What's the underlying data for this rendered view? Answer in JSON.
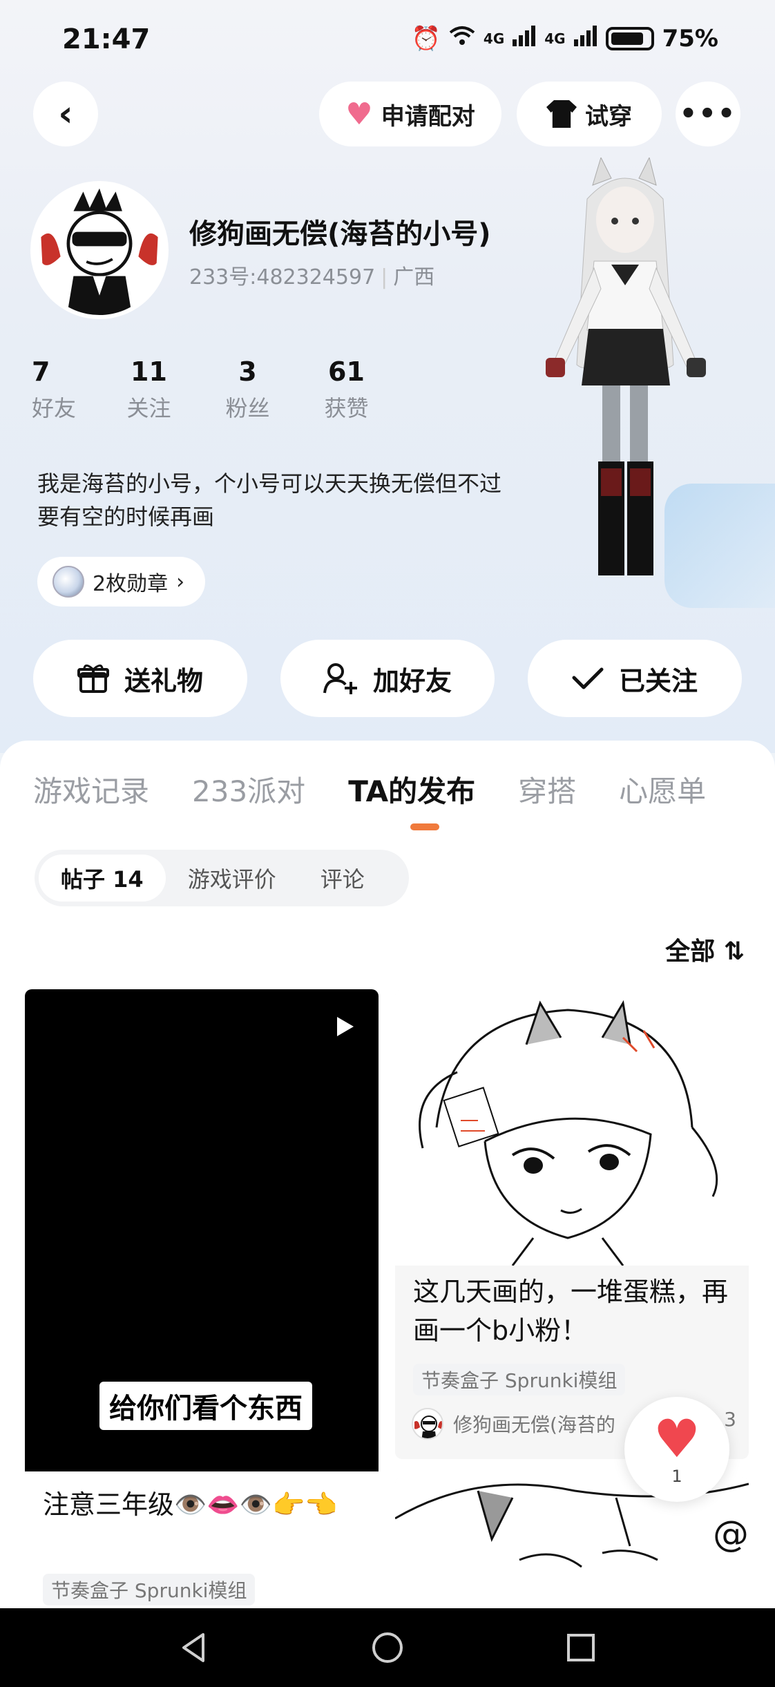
{
  "status_bar": {
    "time": "21:47",
    "network_1": "4G",
    "network_2": "4G",
    "battery": "75%"
  },
  "top_actions": {
    "pair_label": "申请配对",
    "try_label": "试穿"
  },
  "profile": {
    "name": "修狗画无偿(海苔的小号)",
    "id_text": "233号:482324597",
    "location": "广西",
    "stats": [
      {
        "num": "7",
        "label": "好友"
      },
      {
        "num": "11",
        "label": "关注"
      },
      {
        "num": "3",
        "label": "粉丝"
      },
      {
        "num": "61",
        "label": "获赞"
      }
    ],
    "bio": "我是海苔的小号，个小号可以天天换无偿但不过要有空的时候再画",
    "medal_text": "2枚勋章"
  },
  "actions": {
    "gift": "送礼物",
    "add_friend": "加好友",
    "followed": "已关注"
  },
  "tabs": [
    "游戏记录",
    "233派对",
    "TA的发布",
    "穿搭",
    "心愿单"
  ],
  "subtabs": [
    "帖子 14",
    "游戏评价",
    "评论"
  ],
  "sort_label": "全部",
  "posts": [
    {
      "video_caption": "给你们看个东西",
      "title": "注意三年级👁️👄👁️👉👈",
      "tag": "节奏盒子 Sprunki模组"
    },
    {
      "title": "这几天画的，一堆蛋糕，再画一个b小粉！",
      "tag": "节奏盒子 Sprunki模组",
      "author": "修狗画无偿(海苔的",
      "likes": "3"
    }
  ],
  "float_like": {
    "count": "1"
  },
  "colors": {
    "accent": "#f07a3c",
    "heart": "#f0474f",
    "pair_heart": "#f06b8e"
  }
}
